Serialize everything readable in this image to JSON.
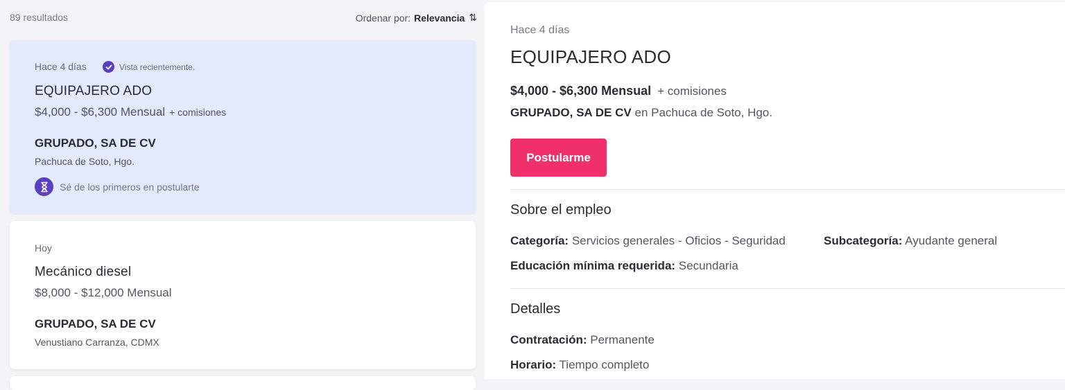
{
  "results": {
    "count_label": "89 resultados",
    "sort_label": "Ordenar por:",
    "sort_value": "Relevancia",
    "sort_icon": "⇅"
  },
  "jobs": [
    {
      "date": "Hace 4 días",
      "viewed_label": "Vista recientemente.",
      "title": "EQUIPAJERO ADO",
      "salary": "$4,000 - $6,300 Mensual",
      "salary_extra": "+ comisiones",
      "company": "GRUPADO, SA DE CV",
      "location": "Pachuca de Soto, Hgo.",
      "first_label": "Sé de los primeros en postularte",
      "selected": true
    },
    {
      "date": "Hoy",
      "title": "Mecánico diesel",
      "salary": "$8,000 - $12,000 Mensual",
      "company": "GRUPADO, SA DE CV",
      "location": "Venustiano Carranza, CDMX",
      "selected": false
    }
  ],
  "detail": {
    "date": "Hace 4 días",
    "title": "EQUIPAJERO ADO",
    "salary": "$4,000 - $6,300 Mensual",
    "salary_extra": "+ comisiones",
    "company": "GRUPADO, SA DE CV",
    "location_prefix": "en",
    "location": "Pachuca de Soto,  Hgo.",
    "apply_label": "Postularme",
    "about_title": "Sobre el empleo",
    "category_label": "Categoría:",
    "category_value": "Servicios generales - Oficios - Seguridad",
    "subcategory_label": "Subcategoría:",
    "subcategory_value": "Ayudante general",
    "education_label": "Educación mínima requerida:",
    "education_value": "Secundaria",
    "details_title": "Detalles",
    "contract_label": "Contratación:",
    "contract_value": "Permanente",
    "schedule_label": "Horario:",
    "schedule_value": "Tiempo completo"
  },
  "colors": {
    "accent_purple": "#5a3fc0",
    "apply_pink": "#f0306a",
    "selected_card": "#e3eafc"
  }
}
